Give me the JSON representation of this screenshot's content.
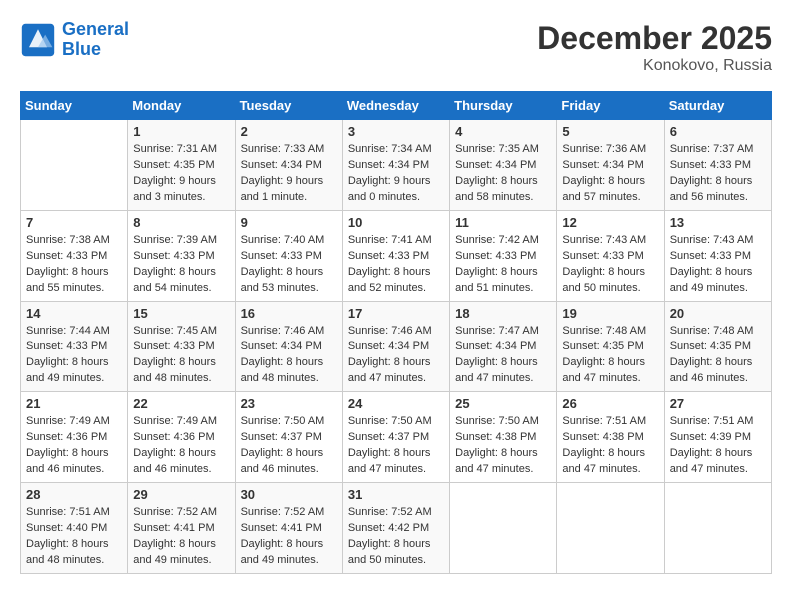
{
  "header": {
    "logo_line1": "General",
    "logo_line2": "Blue",
    "title": "December 2025",
    "subtitle": "Konokovo, Russia"
  },
  "weekdays": [
    "Sunday",
    "Monday",
    "Tuesday",
    "Wednesday",
    "Thursday",
    "Friday",
    "Saturday"
  ],
  "weeks": [
    [
      {
        "day": "",
        "sunrise": "",
        "sunset": "",
        "daylight": ""
      },
      {
        "day": "1",
        "sunrise": "Sunrise: 7:31 AM",
        "sunset": "Sunset: 4:35 PM",
        "daylight": "Daylight: 9 hours and 3 minutes."
      },
      {
        "day": "2",
        "sunrise": "Sunrise: 7:33 AM",
        "sunset": "Sunset: 4:34 PM",
        "daylight": "Daylight: 9 hours and 1 minute."
      },
      {
        "day": "3",
        "sunrise": "Sunrise: 7:34 AM",
        "sunset": "Sunset: 4:34 PM",
        "daylight": "Daylight: 9 hours and 0 minutes."
      },
      {
        "day": "4",
        "sunrise": "Sunrise: 7:35 AM",
        "sunset": "Sunset: 4:34 PM",
        "daylight": "Daylight: 8 hours and 58 minutes."
      },
      {
        "day": "5",
        "sunrise": "Sunrise: 7:36 AM",
        "sunset": "Sunset: 4:34 PM",
        "daylight": "Daylight: 8 hours and 57 minutes."
      },
      {
        "day": "6",
        "sunrise": "Sunrise: 7:37 AM",
        "sunset": "Sunset: 4:33 PM",
        "daylight": "Daylight: 8 hours and 56 minutes."
      }
    ],
    [
      {
        "day": "7",
        "sunrise": "Sunrise: 7:38 AM",
        "sunset": "Sunset: 4:33 PM",
        "daylight": "Daylight: 8 hours and 55 minutes."
      },
      {
        "day": "8",
        "sunrise": "Sunrise: 7:39 AM",
        "sunset": "Sunset: 4:33 PM",
        "daylight": "Daylight: 8 hours and 54 minutes."
      },
      {
        "day": "9",
        "sunrise": "Sunrise: 7:40 AM",
        "sunset": "Sunset: 4:33 PM",
        "daylight": "Daylight: 8 hours and 53 minutes."
      },
      {
        "day": "10",
        "sunrise": "Sunrise: 7:41 AM",
        "sunset": "Sunset: 4:33 PM",
        "daylight": "Daylight: 8 hours and 52 minutes."
      },
      {
        "day": "11",
        "sunrise": "Sunrise: 7:42 AM",
        "sunset": "Sunset: 4:33 PM",
        "daylight": "Daylight: 8 hours and 51 minutes."
      },
      {
        "day": "12",
        "sunrise": "Sunrise: 7:43 AM",
        "sunset": "Sunset: 4:33 PM",
        "daylight": "Daylight: 8 hours and 50 minutes."
      },
      {
        "day": "13",
        "sunrise": "Sunrise: 7:43 AM",
        "sunset": "Sunset: 4:33 PM",
        "daylight": "Daylight: 8 hours and 49 minutes."
      }
    ],
    [
      {
        "day": "14",
        "sunrise": "Sunrise: 7:44 AM",
        "sunset": "Sunset: 4:33 PM",
        "daylight": "Daylight: 8 hours and 49 minutes."
      },
      {
        "day": "15",
        "sunrise": "Sunrise: 7:45 AM",
        "sunset": "Sunset: 4:33 PM",
        "daylight": "Daylight: 8 hours and 48 minutes."
      },
      {
        "day": "16",
        "sunrise": "Sunrise: 7:46 AM",
        "sunset": "Sunset: 4:34 PM",
        "daylight": "Daylight: 8 hours and 48 minutes."
      },
      {
        "day": "17",
        "sunrise": "Sunrise: 7:46 AM",
        "sunset": "Sunset: 4:34 PM",
        "daylight": "Daylight: 8 hours and 47 minutes."
      },
      {
        "day": "18",
        "sunrise": "Sunrise: 7:47 AM",
        "sunset": "Sunset: 4:34 PM",
        "daylight": "Daylight: 8 hours and 47 minutes."
      },
      {
        "day": "19",
        "sunrise": "Sunrise: 7:48 AM",
        "sunset": "Sunset: 4:35 PM",
        "daylight": "Daylight: 8 hours and 47 minutes."
      },
      {
        "day": "20",
        "sunrise": "Sunrise: 7:48 AM",
        "sunset": "Sunset: 4:35 PM",
        "daylight": "Daylight: 8 hours and 46 minutes."
      }
    ],
    [
      {
        "day": "21",
        "sunrise": "Sunrise: 7:49 AM",
        "sunset": "Sunset: 4:36 PM",
        "daylight": "Daylight: 8 hours and 46 minutes."
      },
      {
        "day": "22",
        "sunrise": "Sunrise: 7:49 AM",
        "sunset": "Sunset: 4:36 PM",
        "daylight": "Daylight: 8 hours and 46 minutes."
      },
      {
        "day": "23",
        "sunrise": "Sunrise: 7:50 AM",
        "sunset": "Sunset: 4:37 PM",
        "daylight": "Daylight: 8 hours and 46 minutes."
      },
      {
        "day": "24",
        "sunrise": "Sunrise: 7:50 AM",
        "sunset": "Sunset: 4:37 PM",
        "daylight": "Daylight: 8 hours and 47 minutes."
      },
      {
        "day": "25",
        "sunrise": "Sunrise: 7:50 AM",
        "sunset": "Sunset: 4:38 PM",
        "daylight": "Daylight: 8 hours and 47 minutes."
      },
      {
        "day": "26",
        "sunrise": "Sunrise: 7:51 AM",
        "sunset": "Sunset: 4:38 PM",
        "daylight": "Daylight: 8 hours and 47 minutes."
      },
      {
        "day": "27",
        "sunrise": "Sunrise: 7:51 AM",
        "sunset": "Sunset: 4:39 PM",
        "daylight": "Daylight: 8 hours and 47 minutes."
      }
    ],
    [
      {
        "day": "28",
        "sunrise": "Sunrise: 7:51 AM",
        "sunset": "Sunset: 4:40 PM",
        "daylight": "Daylight: 8 hours and 48 minutes."
      },
      {
        "day": "29",
        "sunrise": "Sunrise: 7:52 AM",
        "sunset": "Sunset: 4:41 PM",
        "daylight": "Daylight: 8 hours and 49 minutes."
      },
      {
        "day": "30",
        "sunrise": "Sunrise: 7:52 AM",
        "sunset": "Sunset: 4:41 PM",
        "daylight": "Daylight: 8 hours and 49 minutes."
      },
      {
        "day": "31",
        "sunrise": "Sunrise: 7:52 AM",
        "sunset": "Sunset: 4:42 PM",
        "daylight": "Daylight: 8 hours and 50 minutes."
      },
      {
        "day": "",
        "sunrise": "",
        "sunset": "",
        "daylight": ""
      },
      {
        "day": "",
        "sunrise": "",
        "sunset": "",
        "daylight": ""
      },
      {
        "day": "",
        "sunrise": "",
        "sunset": "",
        "daylight": ""
      }
    ]
  ]
}
